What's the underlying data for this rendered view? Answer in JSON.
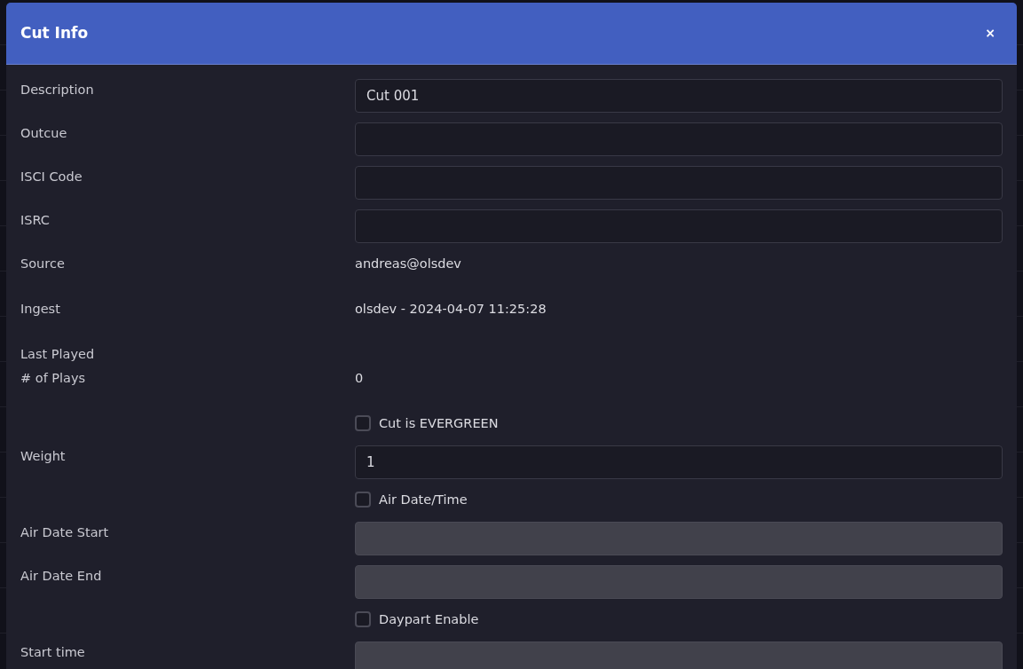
{
  "dialog": {
    "title": "Cut Info",
    "close": "×"
  },
  "rows": [
    {
      "kind": "input",
      "label": "Description",
      "value": "Cut 001",
      "disabled": false
    },
    {
      "kind": "input",
      "label": "Outcue",
      "value": "",
      "disabled": false
    },
    {
      "kind": "input",
      "label": "ISCI Code",
      "value": "",
      "disabled": false
    },
    {
      "kind": "input",
      "label": "ISRC",
      "value": "",
      "disabled": false
    },
    {
      "kind": "text",
      "label": "Source",
      "value": "andreas@olsdev"
    },
    {
      "kind": "text",
      "label": "Ingest",
      "value": "olsdev - 2024-04-07 11:25:28"
    },
    {
      "kind": "label",
      "label": "Last Played"
    },
    {
      "kind": "text",
      "label": "# of Plays",
      "value": "0"
    },
    {
      "kind": "checkbox",
      "label": "Cut is EVERGREEN",
      "checked": false
    },
    {
      "kind": "input",
      "label": "Weight",
      "value": "1",
      "disabled": false
    },
    {
      "kind": "checkbox",
      "label": "Air Date/Time",
      "checked": false
    },
    {
      "kind": "input",
      "label": "Air Date Start",
      "value": "",
      "disabled": true
    },
    {
      "kind": "input",
      "label": "Air Date End",
      "value": "",
      "disabled": true
    },
    {
      "kind": "checkbox",
      "label": "Daypart Enable",
      "checked": false
    },
    {
      "kind": "input",
      "label": "Start time",
      "value": "",
      "disabled": true
    }
  ]
}
